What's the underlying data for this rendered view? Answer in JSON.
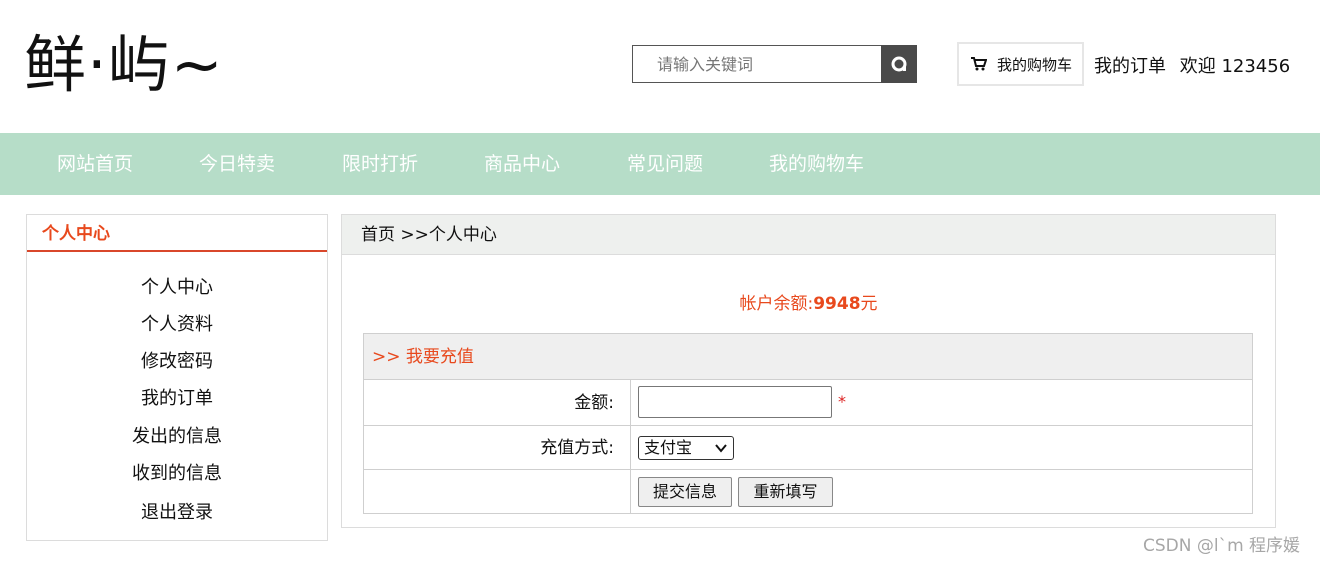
{
  "header": {
    "logo": "鲜·屿~",
    "search_placeholder": "请输入关键词",
    "cart_label": "我的购物车",
    "my_orders": "我的订单",
    "welcome": "欢迎 123456"
  },
  "nav": {
    "items": [
      "网站首页",
      "今日特卖",
      "限时打折",
      "商品中心",
      "常见问题",
      "我的购物车"
    ]
  },
  "sidebar": {
    "title": "个人中心",
    "items": [
      "个人中心",
      "个人资料",
      "修改密码",
      "我的订单",
      "发出的信息",
      "收到的信息",
      "退出登录"
    ]
  },
  "main": {
    "breadcrumb": "首页 >>个人中心",
    "balance_label": "帐户余额:",
    "balance_value": "9948",
    "balance_unit": "元",
    "form": {
      "title": ">> 我要充值",
      "amount_label": "金额:",
      "amount_value": "",
      "required_mark": "*",
      "method_label": "充值方式:",
      "method_selected": "支付宝",
      "submit_label": "提交信息",
      "reset_label": "重新填写"
    }
  },
  "watermark": "CSDN @l`m 程序媛",
  "colors": {
    "nav_bg": "#b6ddc8",
    "accent": "#e8491d"
  }
}
